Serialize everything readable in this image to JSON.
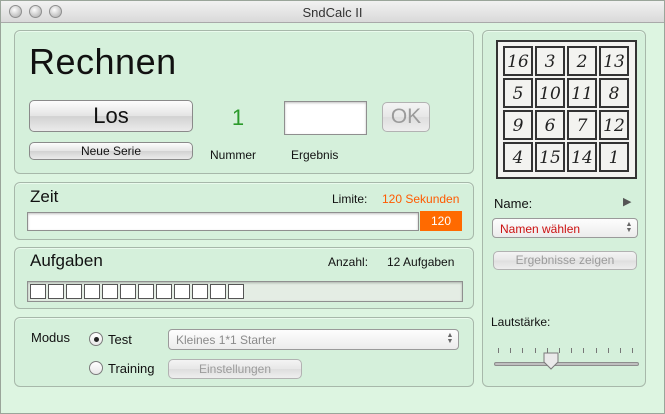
{
  "window": {
    "title": "SndCalc II"
  },
  "rechnen": {
    "heading": "Rechnen",
    "los_label": "Los",
    "neue_serie_label": "Neue Serie",
    "nummer_value": "1",
    "nummer_label": "Nummer",
    "ergebnis_label": "Ergebnis",
    "ergebnis_value": "",
    "ok_label": "OK"
  },
  "zeit": {
    "heading": "Zeit",
    "limite_label": "Limite:",
    "limite_value": "120 Sekunden",
    "remaining": "120",
    "progress_fraction": 1.0
  },
  "aufgaben": {
    "heading": "Aufgaben",
    "anzahl_label": "Anzahl:",
    "anzahl_value": "12 Aufgaben",
    "boxes_count": 12
  },
  "modus": {
    "label": "Modus",
    "test_label": "Test",
    "training_label": "Training",
    "selected": "Test",
    "set_value": "Kleines 1*1 Starter",
    "einstellungen_label": "Einstellungen"
  },
  "side": {
    "name_label": "Name:",
    "name_select_value": "Namen wählen",
    "ergebnisse_label": "Ergebnisse zeigen",
    "lautstaerke_label": "Lautstärke:",
    "volume_fraction": 0.38,
    "magic_square": [
      "16",
      "3",
      "2",
      "13",
      "5",
      "10",
      "11",
      "8",
      "9",
      "6",
      "7",
      "12",
      "4",
      "15",
      "14",
      "1"
    ]
  },
  "colors": {
    "accent_green": "#2b9a2b",
    "accent_orange": "#ff6a00",
    "name_select_red": "#cc1111",
    "limite_orange": "#ff5a00"
  }
}
